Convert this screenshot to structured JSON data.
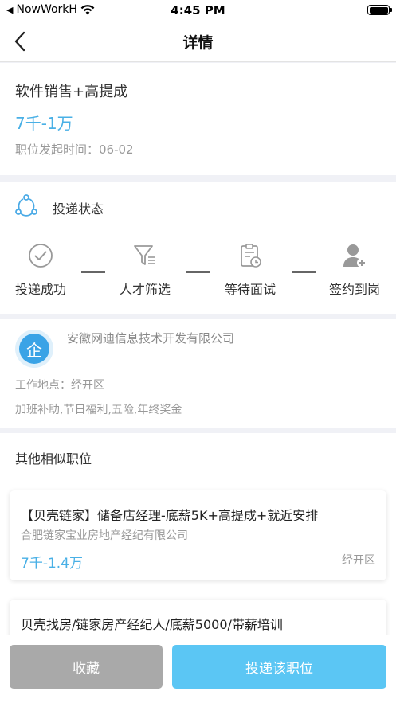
{
  "status_bar": {
    "carrier": "NowWorkH",
    "time": "4:45 PM"
  },
  "nav": {
    "title": "详情"
  },
  "job": {
    "title": "软件销售+高提成",
    "salary": "7千-1万",
    "posted": "职位发起时间：06-02"
  },
  "delivery": {
    "title": "投递状态",
    "steps": [
      {
        "label": "投递成功",
        "icon": "check-circle-icon"
      },
      {
        "label": "人才筛选",
        "icon": "filter-icon"
      },
      {
        "label": "等待面试",
        "icon": "clipboard-clock-icon"
      },
      {
        "label": "签约到岗",
        "icon": "person-add-icon"
      }
    ]
  },
  "company": {
    "logo_char": "企",
    "name": "安徽网迪信息技术开发有限公司",
    "location": "工作地点：经开区",
    "benefits": "加班补助,节日福利,五险,年终奖金"
  },
  "similar": {
    "title": "其他相似职位",
    "items": [
      {
        "title": "【贝壳链家】储备店经理-底薪5K+高提成+就近安排",
        "company": "合肥链家宝业房地产经纪有限公司",
        "salary": "7千-1.4万",
        "location": "经开区"
      },
      {
        "title": "贝壳找房/链家房产经纪人/底薪5000/带薪培训"
      }
    ]
  },
  "actions": {
    "collect": "收藏",
    "apply": "投递该职位"
  },
  "colors": {
    "accent": "#49b0e6",
    "apply_button": "#5bc6f4",
    "collect_button": "#a9a9a9"
  }
}
